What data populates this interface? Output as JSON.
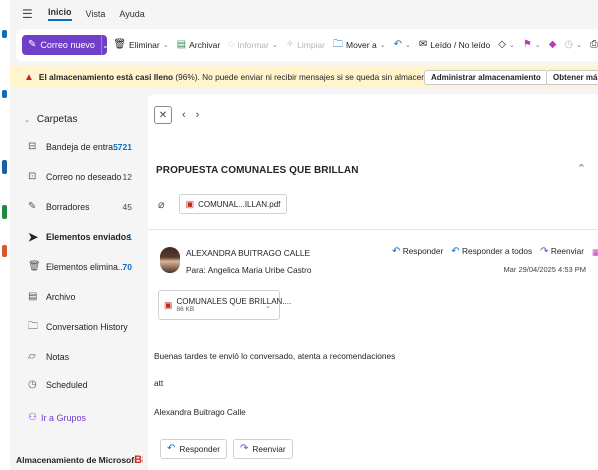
{
  "menu": {
    "tabs": [
      "Inicio",
      "Vista",
      "Ayuda"
    ]
  },
  "ribbon": {
    "new_mail": "Correo nuevo",
    "delete": "Eliminar",
    "archive": "Archivar",
    "report": "Informar",
    "sweep": "Limpiar",
    "move_to": "Mover a",
    "read_unread": "Leído / No leído"
  },
  "warning": {
    "strong": "El almacenamiento está casi lleno",
    "percent": "(96%).",
    "text": "No puede enviar ni recibir mensajes si se queda sin almacenamiento.",
    "manage_button": "Administrar almacenamiento",
    "get_more_button": "Obtener má"
  },
  "sidebar": {
    "folders_header": "Carpetas",
    "items": [
      {
        "label": "Bandeja de entra...",
        "count": "5721",
        "icon": "inbox-icon"
      },
      {
        "label": "Correo no deseado",
        "count": "12",
        "icon": "junk-icon"
      },
      {
        "label": "Borradores",
        "count": "45",
        "icon": "drafts-icon"
      },
      {
        "label": "Elementos enviados",
        "count": "1",
        "icon": "sent-icon"
      },
      {
        "label": "Elementos elimina...",
        "count": "70",
        "icon": "trash-icon"
      },
      {
        "label": "Archivo",
        "count": "",
        "icon": "archive-icon"
      },
      {
        "label": "Conversation History",
        "count": "",
        "icon": "folder-icon"
      },
      {
        "label": "Notas",
        "count": "",
        "icon": "notes-icon"
      },
      {
        "label": "Scheduled",
        "count": "",
        "icon": "clock-icon"
      }
    ],
    "groups": "Ir a Grupos",
    "storage_label": "Almacenamiento de Microsof",
    "storage_logo_text": "BNC"
  },
  "message": {
    "subject": "PROPUESTA COMUNALES QUE BRILLAN",
    "attachment_top": "COMUNAL...ILLAN.pdf",
    "sender": "ALEXANDRA BUITRAGO CALLE",
    "to_label": "Para:",
    "to": "Angelica Maria Uribe Castro",
    "reply": "Responder",
    "reply_all": "Responder a todos",
    "forward": "Reenviar",
    "date": "Mar 29/04/2025 4:53 PM",
    "attachment_name": "COMUNALES QUE BRILLAN....",
    "attachment_size": "86 KB",
    "body_1": "Buenas tardes te envió lo conversado, atenta a recomendaciones",
    "body_2": "att",
    "body_3": "Alexandra Buitrago Calle",
    "reply_button": "Responder",
    "forward_button": "Reenviar"
  },
  "colors": {
    "accent": "#0f6cbd",
    "brand": "#6f3fc7",
    "warning_bg": "#fff4ce",
    "danger": "#c42b1c"
  }
}
